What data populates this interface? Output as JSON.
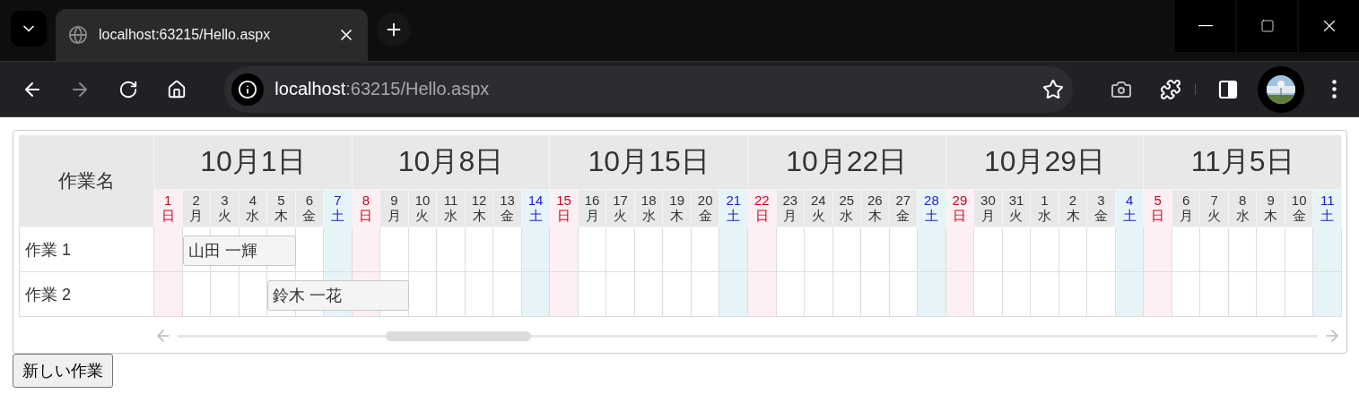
{
  "browser": {
    "tab_title": "localhost:63215/Hello.aspx",
    "url_host": "localhost",
    "url_rest": ":63215/Hello.aspx"
  },
  "gantt": {
    "name_header": "作業名",
    "weeks": [
      "10月1日",
      "10月8日",
      "10月15日",
      "10月22日",
      "10月29日",
      "11月5日"
    ],
    "days": [
      {
        "date": "1",
        "weekday": "日",
        "kind": "sunday"
      },
      {
        "date": "2",
        "weekday": "月",
        "kind": "weekday"
      },
      {
        "date": "3",
        "weekday": "火",
        "kind": "weekday"
      },
      {
        "date": "4",
        "weekday": "水",
        "kind": "weekday"
      },
      {
        "date": "5",
        "weekday": "木",
        "kind": "weekday"
      },
      {
        "date": "6",
        "weekday": "金",
        "kind": "weekday"
      },
      {
        "date": "7",
        "weekday": "土",
        "kind": "saturday"
      },
      {
        "date": "8",
        "weekday": "日",
        "kind": "sunday"
      },
      {
        "date": "9",
        "weekday": "月",
        "kind": "weekday"
      },
      {
        "date": "10",
        "weekday": "火",
        "kind": "weekday"
      },
      {
        "date": "11",
        "weekday": "水",
        "kind": "weekday"
      },
      {
        "date": "12",
        "weekday": "木",
        "kind": "weekday"
      },
      {
        "date": "13",
        "weekday": "金",
        "kind": "weekday"
      },
      {
        "date": "14",
        "weekday": "土",
        "kind": "saturday"
      },
      {
        "date": "15",
        "weekday": "日",
        "kind": "sunday"
      },
      {
        "date": "16",
        "weekday": "月",
        "kind": "weekday"
      },
      {
        "date": "17",
        "weekday": "火",
        "kind": "weekday"
      },
      {
        "date": "18",
        "weekday": "水",
        "kind": "weekday"
      },
      {
        "date": "19",
        "weekday": "木",
        "kind": "weekday"
      },
      {
        "date": "20",
        "weekday": "金",
        "kind": "weekday"
      },
      {
        "date": "21",
        "weekday": "土",
        "kind": "saturday"
      },
      {
        "date": "22",
        "weekday": "日",
        "kind": "sunday"
      },
      {
        "date": "23",
        "weekday": "月",
        "kind": "weekday"
      },
      {
        "date": "24",
        "weekday": "火",
        "kind": "weekday"
      },
      {
        "date": "25",
        "weekday": "水",
        "kind": "weekday"
      },
      {
        "date": "26",
        "weekday": "木",
        "kind": "weekday"
      },
      {
        "date": "27",
        "weekday": "金",
        "kind": "weekday"
      },
      {
        "date": "28",
        "weekday": "土",
        "kind": "saturday"
      },
      {
        "date": "29",
        "weekday": "日",
        "kind": "sunday"
      },
      {
        "date": "30",
        "weekday": "月",
        "kind": "weekday"
      },
      {
        "date": "31",
        "weekday": "火",
        "kind": "weekday"
      },
      {
        "date": "1",
        "weekday": "水",
        "kind": "weekday"
      },
      {
        "date": "2",
        "weekday": "木",
        "kind": "weekday"
      },
      {
        "date": "3",
        "weekday": "金",
        "kind": "weekday"
      },
      {
        "date": "4",
        "weekday": "土",
        "kind": "saturday"
      },
      {
        "date": "5",
        "weekday": "日",
        "kind": "sunday"
      },
      {
        "date": "6",
        "weekday": "月",
        "kind": "weekday"
      },
      {
        "date": "7",
        "weekday": "火",
        "kind": "weekday"
      },
      {
        "date": "8",
        "weekday": "水",
        "kind": "weekday"
      },
      {
        "date": "9",
        "weekday": "木",
        "kind": "weekday"
      },
      {
        "date": "10",
        "weekday": "金",
        "kind": "weekday"
      },
      {
        "date": "11",
        "weekday": "土",
        "kind": "saturday"
      }
    ],
    "tasks": [
      {
        "name": "作業 1",
        "assignee": "山田 一輝",
        "scheduled": [
          false,
          true,
          true,
          true,
          true,
          false,
          false,
          false,
          false,
          false,
          false,
          false,
          false,
          false,
          false,
          false,
          false,
          false,
          false,
          false,
          false,
          false,
          false,
          false,
          false,
          false,
          false,
          false,
          false,
          false,
          false,
          false,
          false,
          false,
          false,
          false,
          false,
          false,
          false,
          false,
          false,
          false
        ]
      },
      {
        "name": "作業 2",
        "assignee": "鈴木 一花",
        "scheduled": [
          false,
          false,
          false,
          false,
          true,
          true,
          true,
          true,
          true,
          false,
          false,
          false,
          false,
          false,
          false,
          false,
          false,
          false,
          false,
          false,
          false,
          false,
          false,
          false,
          false,
          false,
          false,
          false,
          false,
          false,
          false,
          false,
          false,
          false,
          false,
          false,
          false,
          false,
          false,
          false,
          false,
          false
        ]
      }
    ]
  },
  "new_task_button": "新しい作業"
}
